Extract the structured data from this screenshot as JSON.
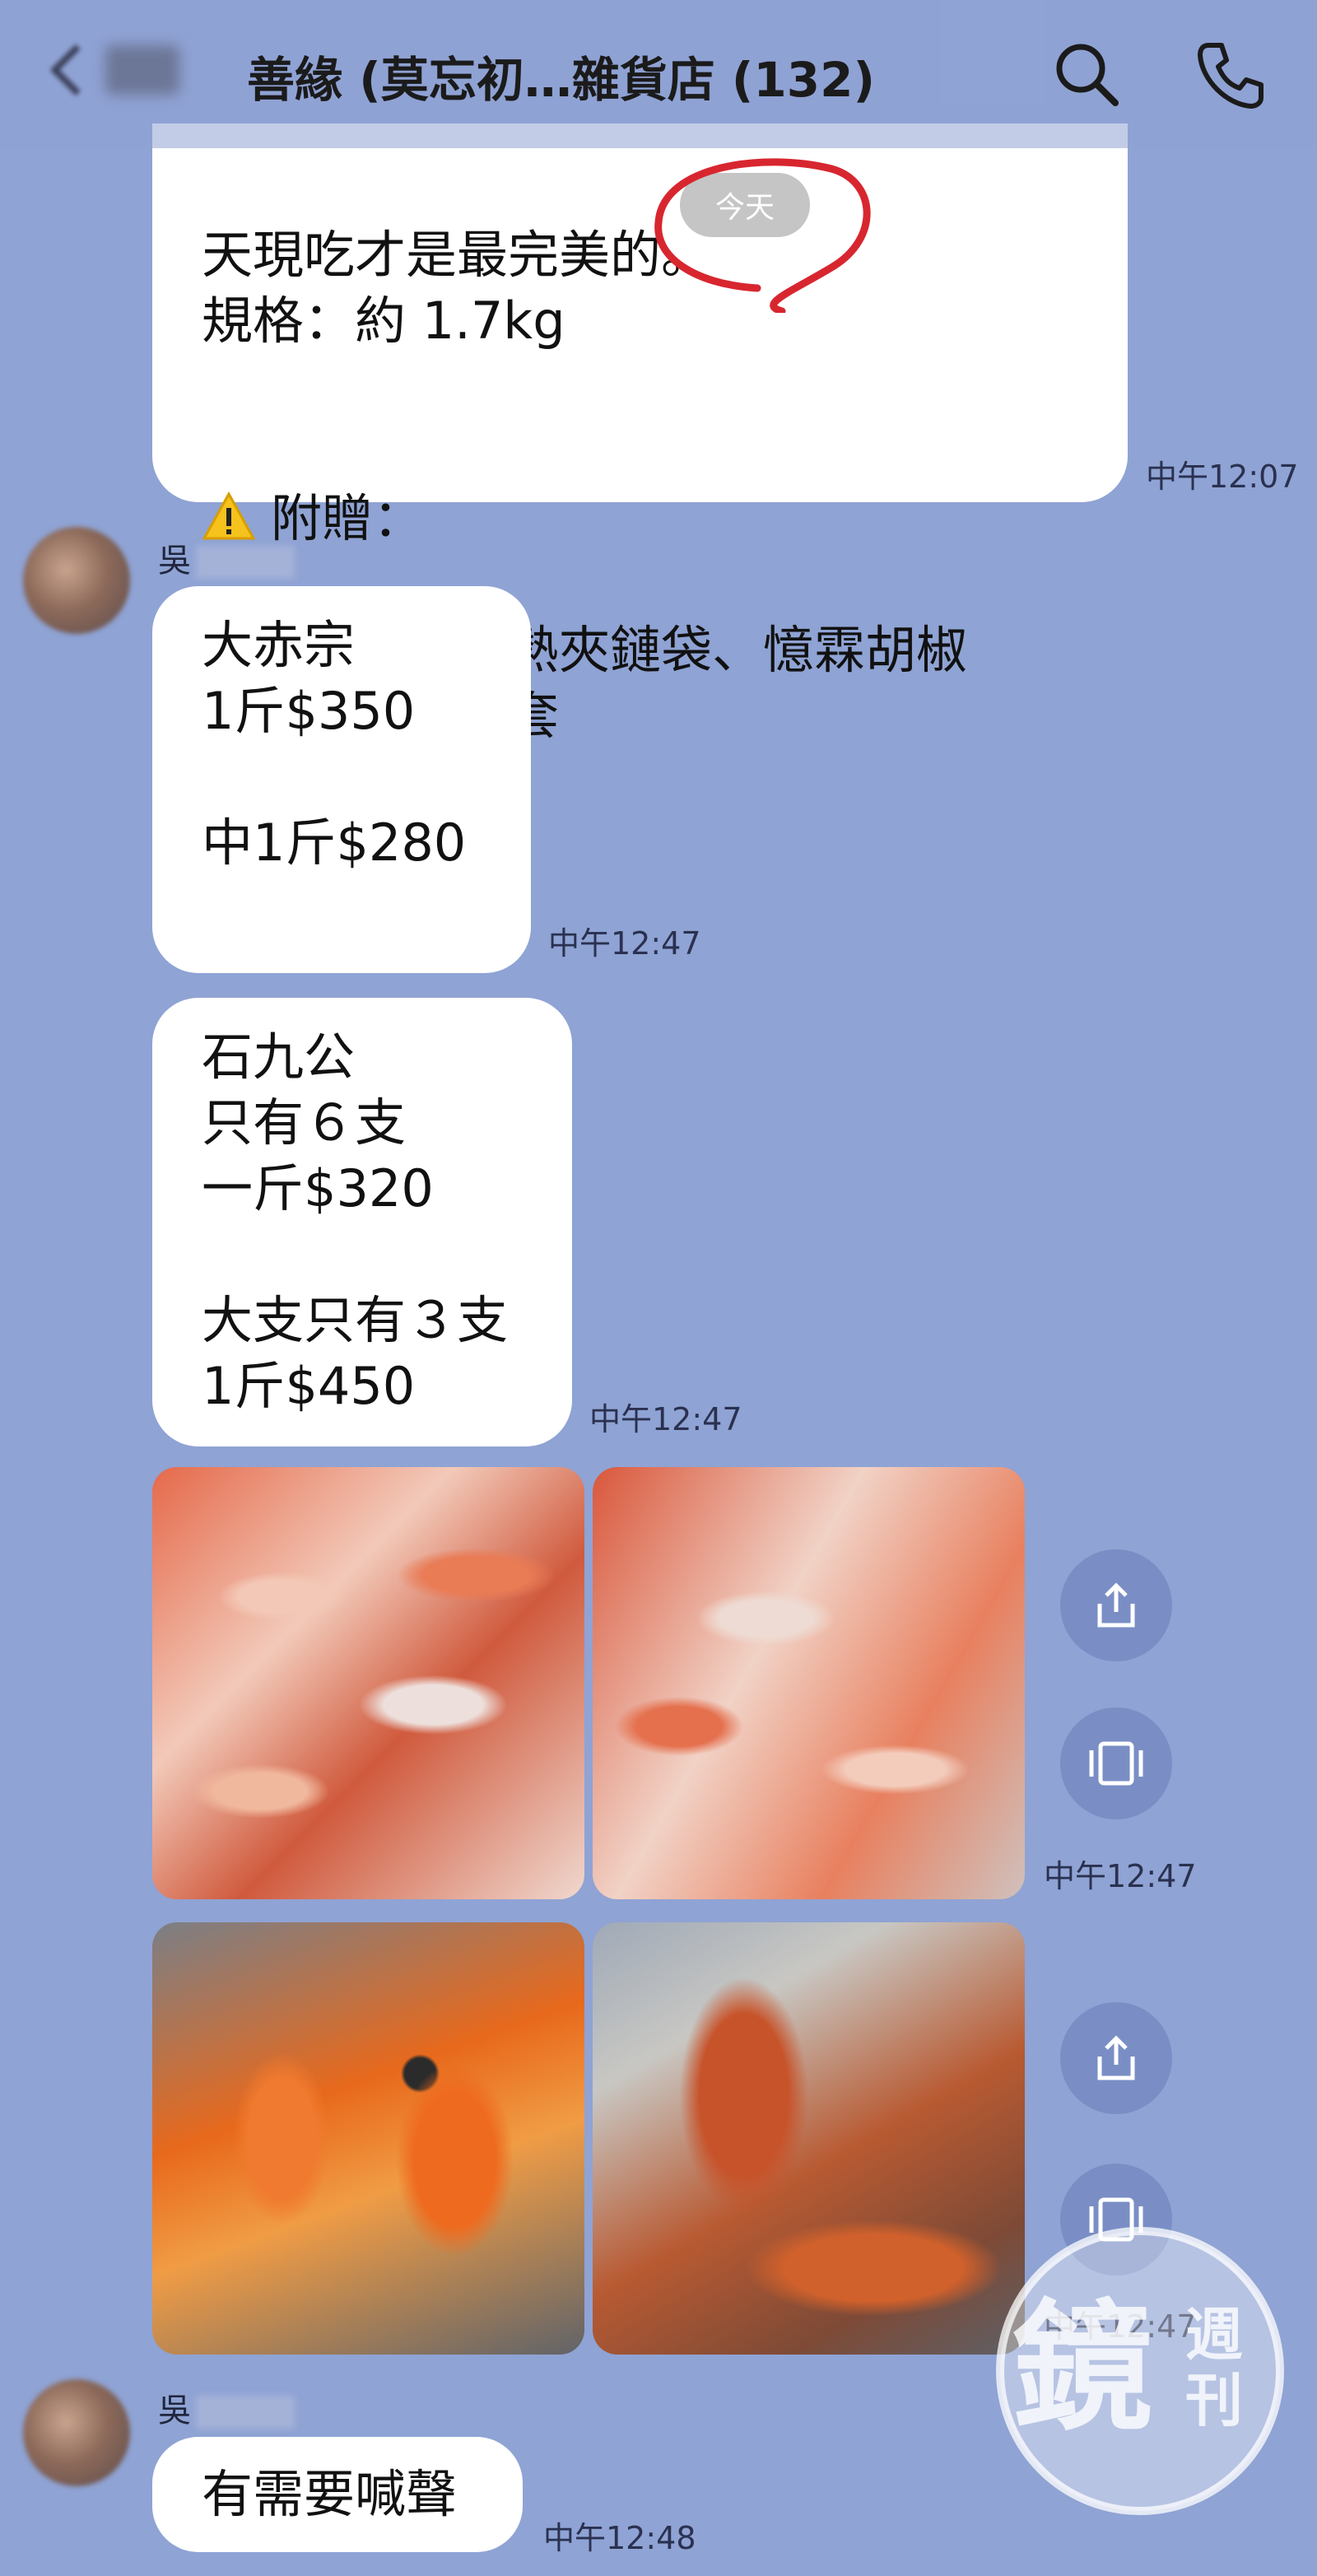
{
  "header": {
    "title": "善緣 (莫忘初…雜貨店 (132)"
  },
  "today_label": "今天",
  "messages": {
    "m1": {
      "text": "天現吃才是最完美的。\n規格：約 1.7kg",
      "gift_label": "附贈：",
      "gift_text": "手扒雞專用耐熱夾鏈袋、憶霖胡椒\n鹽、手扒雞手套",
      "time": "中午12:07"
    },
    "sender1": "吳",
    "m2": {
      "text": "大赤宗\n1斤$350\n\n中1斤$280",
      "time": "中午12:47"
    },
    "m3": {
      "text": "石九公\n只有６支\n一斤$320\n\n大支只有３支\n1斤$450",
      "time": "中午12:47"
    },
    "photos1_time": "中午12:47",
    "photos2_time": "中午12:47",
    "sender2": "吳",
    "m4": {
      "text": "有需要喊聲",
      "time": "中午12:48"
    }
  },
  "watermark": {
    "text": "鏡週刊"
  },
  "colors": {
    "background": "#8fa3d4",
    "bubble": "#ffffff",
    "annotation": "#d8262f"
  }
}
